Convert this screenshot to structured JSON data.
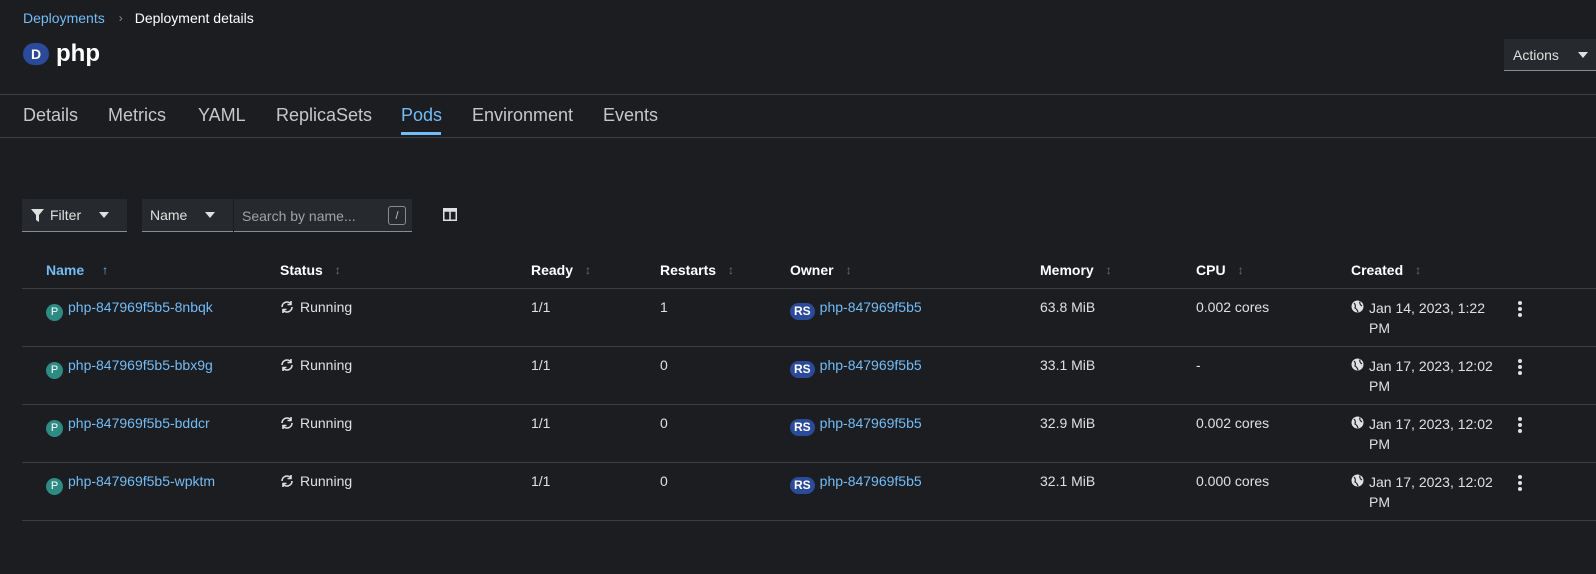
{
  "breadcrumb": {
    "parent": "Deployments",
    "current": "Deployment details"
  },
  "header": {
    "kind_badge": "D",
    "title": "php",
    "actions_label": "Actions"
  },
  "tabs": [
    {
      "label": "Details"
    },
    {
      "label": "Metrics"
    },
    {
      "label": "YAML"
    },
    {
      "label": "ReplicaSets"
    },
    {
      "label": "Pods",
      "active": true
    },
    {
      "label": "Environment"
    },
    {
      "label": "Events"
    }
  ],
  "toolbar": {
    "filter_label": "Filter",
    "name_select": "Name",
    "search_placeholder": "Search by name...",
    "search_shortcut": "/"
  },
  "table": {
    "columns": [
      "Name",
      "Status",
      "Ready",
      "Restarts",
      "Owner",
      "Memory",
      "CPU",
      "Created"
    ],
    "sorted_column": "Name",
    "rows": [
      {
        "badge": "P",
        "name": "php-847969f5b5-8nbqk",
        "status": "Running",
        "ready": "1/1",
        "restarts": "1",
        "owner_badge": "RS",
        "owner": "php-847969f5b5",
        "memory": "63.8 MiB",
        "cpu": "0.002 cores",
        "created": "Jan 14, 2023, 1:22 PM"
      },
      {
        "badge": "P",
        "name": "php-847969f5b5-bbx9g",
        "status": "Running",
        "ready": "1/1",
        "restarts": "0",
        "owner_badge": "RS",
        "owner": "php-847969f5b5",
        "memory": "33.1 MiB",
        "cpu": "-",
        "created": "Jan 17, 2023, 12:02 PM"
      },
      {
        "badge": "P",
        "name": "php-847969f5b5-bddcr",
        "status": "Running",
        "ready": "1/1",
        "restarts": "0",
        "owner_badge": "RS",
        "owner": "php-847969f5b5",
        "memory": "32.9 MiB",
        "cpu": "0.002 cores",
        "created": "Jan 17, 2023, 12:02 PM"
      },
      {
        "badge": "P",
        "name": "php-847969f5b5-wpktm",
        "status": "Running",
        "ready": "1/1",
        "restarts": "0",
        "owner_badge": "RS",
        "owner": "php-847969f5b5",
        "memory": "32.1 MiB",
        "cpu": "0.000 cores",
        "created": "Jan 17, 2023, 12:02 PM"
      }
    ]
  },
  "colors": {
    "link": "#73bcf7",
    "background": "#1b1d21",
    "pod_badge": "#2e8b84",
    "rs_badge": "#2b4a9a"
  }
}
